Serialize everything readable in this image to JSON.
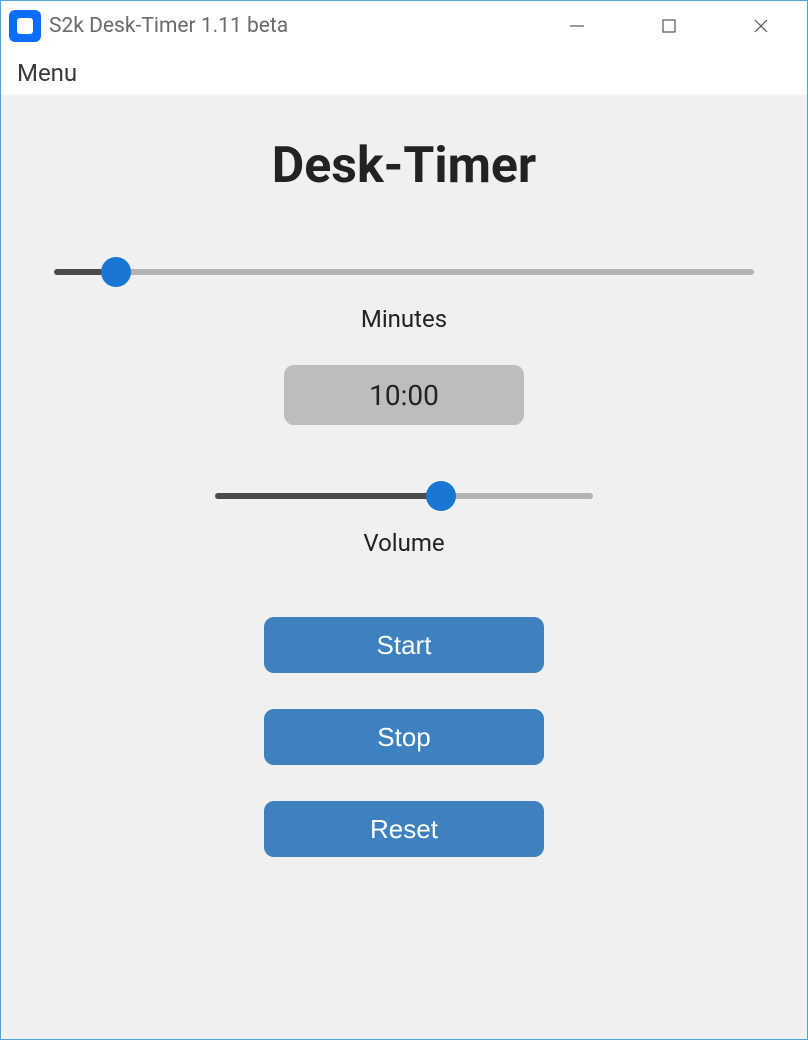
{
  "window": {
    "title": "S2k Desk-Timer 1.11 beta"
  },
  "menubar": {
    "menu": "Menu"
  },
  "app": {
    "heading": "Desk-Timer"
  },
  "sliders": {
    "minutes": {
      "label": "Minutes",
      "value_percent": 9
    },
    "volume": {
      "label": "Volume",
      "value_percent": 60
    }
  },
  "time_display": {
    "value": "10:00"
  },
  "buttons": {
    "start": "Start",
    "stop": "Stop",
    "reset": "Reset"
  },
  "icons": {
    "app_icon": "square-app-icon",
    "minimize": "minimize-icon",
    "maximize": "maximize-icon",
    "close": "close-icon"
  },
  "colors": {
    "accent": "#1976d2",
    "button": "#3d81bf",
    "content_bg": "#f0f0f0",
    "display_bg": "#bdbdbd"
  }
}
